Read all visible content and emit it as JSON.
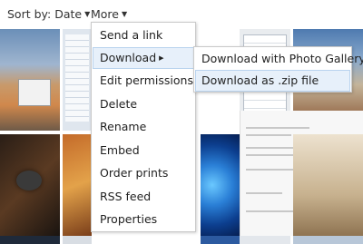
{
  "toolbar": {
    "sort_label": "Sort by: Date",
    "more_label": "More"
  },
  "menu": {
    "items": [
      {
        "label": "Send a link"
      },
      {
        "label": "Download"
      },
      {
        "label": "Edit permissions"
      },
      {
        "label": "Delete"
      },
      {
        "label": "Rename"
      },
      {
        "label": "Embed"
      },
      {
        "label": "Order prints"
      },
      {
        "label": "RSS feed"
      },
      {
        "label": "Properties"
      }
    ],
    "active_item": "Download"
  },
  "submenu": {
    "items": [
      {
        "label": "Download with Photo Gallery"
      },
      {
        "label": "Download as .zip file"
      }
    ],
    "active_item": "Download as .zip file"
  },
  "colors": {
    "highlight_bg": "#e7f0fa",
    "highlight_border": "#b9d3ee",
    "menu_border": "#c9c9c9"
  },
  "icons": {
    "dropdown": "chevron-down-icon",
    "submenu": "chevron-right-icon"
  }
}
